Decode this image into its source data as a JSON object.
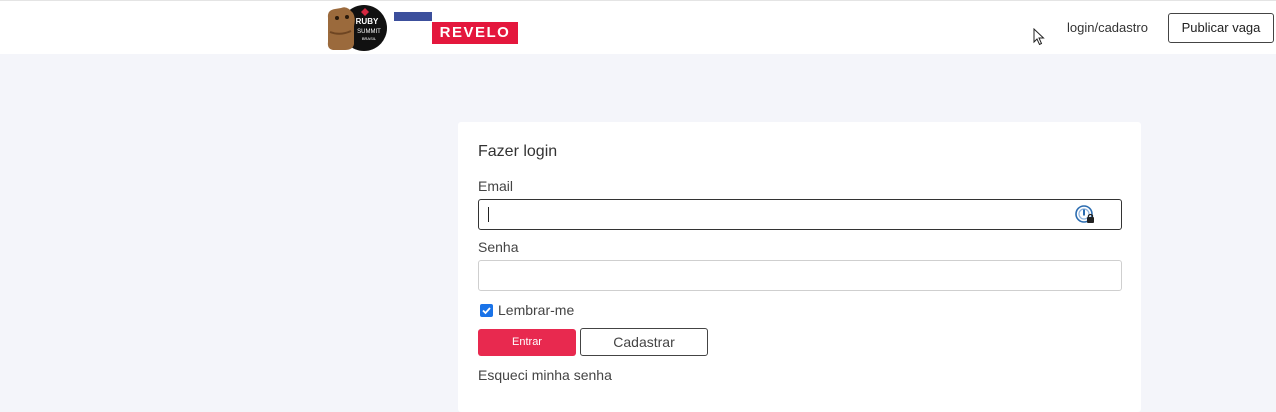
{
  "header": {
    "logo_ruby_text": [
      "RUBY",
      "SUMMIT",
      "BRASIL"
    ],
    "logo_revelo_text": "REVELO",
    "login_link": "login/cadastro",
    "publish_button": "Publicar vaga"
  },
  "login_form": {
    "title": "Fazer login",
    "email_label": "Email",
    "email_value": "",
    "password_label": "Senha",
    "password_value": "",
    "remember_label": "Lembrar-me",
    "remember_checked": true,
    "submit_button": "Entrar",
    "register_button": "Cadastrar",
    "forgot_link": "Esqueci minha senha"
  },
  "colors": {
    "page_background": "#f4f5fa",
    "revelo_red": "#e4173d",
    "revelo_blue": "#3c4f9c",
    "primary_button": "#e8294f",
    "checkbox_blue": "#1a73e8"
  },
  "icons": [
    "mouse-cursor-icon",
    "password-manager-icon",
    "checkmark-icon"
  ]
}
